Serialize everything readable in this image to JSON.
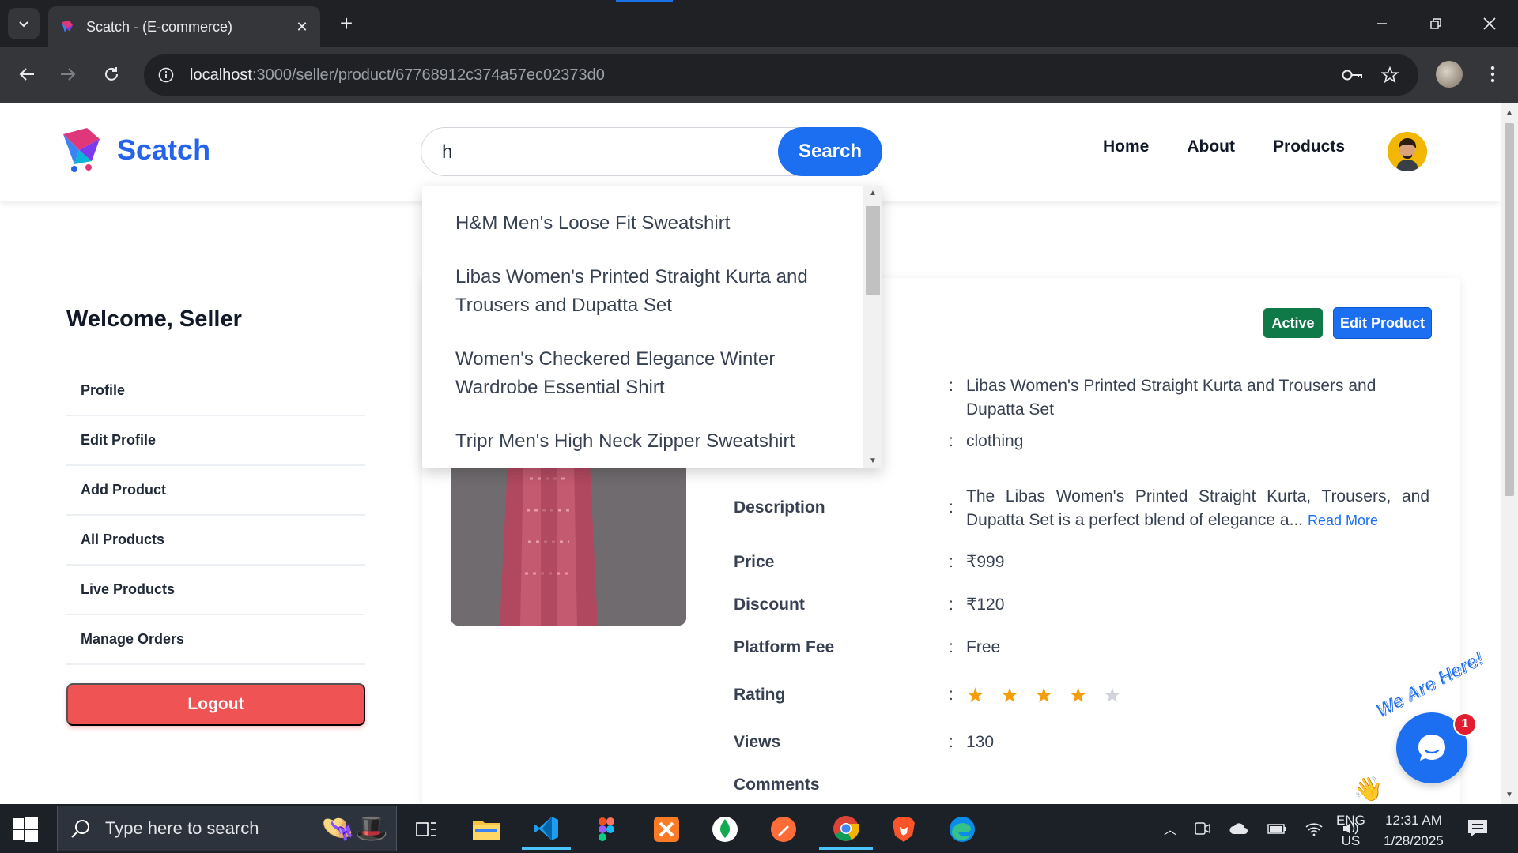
{
  "browser": {
    "tab_title": "Scatch - (E-commerce)",
    "url_host": "localhost",
    "url_rest": ":3000/seller/product/67768912c374a57ec02373d0"
  },
  "site": {
    "brand": "Scatch",
    "search": {
      "value": "h",
      "button": "Search"
    },
    "nav": [
      "Home",
      "About",
      "Products"
    ]
  },
  "suggestions": [
    "H&M Men's Loose Fit Sweatshirt",
    "Libas Women's Printed Straight Kurta and Trousers and Dupatta Set",
    "Women's Checkered Elegance Winter Wardrobe Essential Shirt",
    "Tripr Men's High Neck Zipper Sweatshirt"
  ],
  "sidebar": {
    "welcome": "Welcome, Seller",
    "items": [
      "Profile",
      "Edit Profile",
      "Add Product",
      "All Products",
      "Live Products",
      "Manage Orders"
    ],
    "logout": "Logout"
  },
  "product": {
    "status_badge": "Active",
    "edit_button": "Edit Product",
    "name_value": "Libas Women's Printed Straight Kurta and Trousers and Dupatta Set",
    "category_value": "clothing",
    "description_label": "Description",
    "description_value": "The Libas Women's Printed Straight Kurta, Trousers, and Dupatta Set is a perfect blend of elegance a...",
    "read_more": "Read More",
    "price_label": "Price",
    "price_value": "₹999",
    "discount_label": "Discount",
    "discount_value": "₹120",
    "fee_label": "Platform Fee",
    "fee_value": "Free",
    "rating_label": "Rating",
    "rating": 4,
    "rating_max": 5,
    "views_label": "Views",
    "views_value": "130",
    "comments_label": "Comments",
    "colon": ":"
  },
  "chat": {
    "greeting": "We Are Here!",
    "unread": "1"
  },
  "taskbar": {
    "search_placeholder": "Type here to search",
    "lang_top": "ENG",
    "lang_bottom": "US",
    "time": "12:31 AM",
    "date": "1/28/2025"
  },
  "colors": {
    "brand_blue": "#1d6ff2",
    "logout_red": "#ef5353",
    "active_green": "#0f7a48",
    "star": "#f59e0b"
  }
}
